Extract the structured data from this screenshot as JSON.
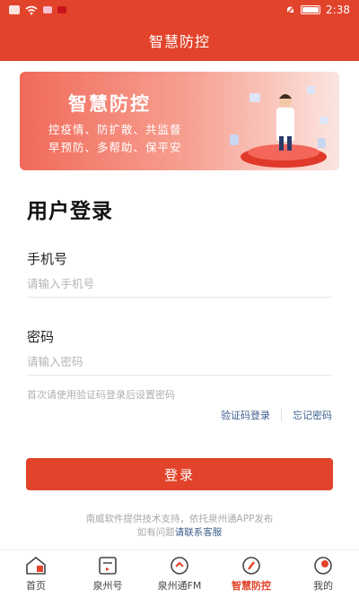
{
  "status_bar": {
    "time": "2:38",
    "icons": [
      "notification-icon",
      "wifi-icon",
      "app-icon",
      "flag-icon",
      "mute-icon",
      "battery-icon"
    ]
  },
  "app_bar": {
    "title": "智慧防控"
  },
  "banner": {
    "title": "智慧防控",
    "line1": "控疫情、防扩散、共监督",
    "line2": "早预防、多帮助、保平安"
  },
  "login": {
    "title": "用户登录",
    "phone_label": "手机号",
    "phone_placeholder": "请输入手机号",
    "phone_value": "",
    "password_label": "密码",
    "password_placeholder": "请输入密码",
    "password_value": "",
    "hint": "首次请使用验证码登录后设置密码",
    "code_login_link": "验证码登录",
    "forgot_link": "忘记密码",
    "submit_label": "登录"
  },
  "footer": {
    "support_text": "南威软件提供技术支持，依托泉州通APP发布",
    "question_text": "如有问题",
    "contact_link": "请联系客服"
  },
  "tabs": [
    {
      "label": "首页",
      "icon": "home-icon",
      "active": false
    },
    {
      "label": "泉州号",
      "icon": "news-icon",
      "active": false
    },
    {
      "label": "泉州通FM",
      "icon": "radio-icon",
      "active": false
    },
    {
      "label": "智慧防控",
      "icon": "shield-icon",
      "active": true
    },
    {
      "label": "我的",
      "icon": "profile-icon",
      "active": false
    }
  ],
  "colors": {
    "accent": "#e2432b",
    "link": "#3c5f8c"
  }
}
